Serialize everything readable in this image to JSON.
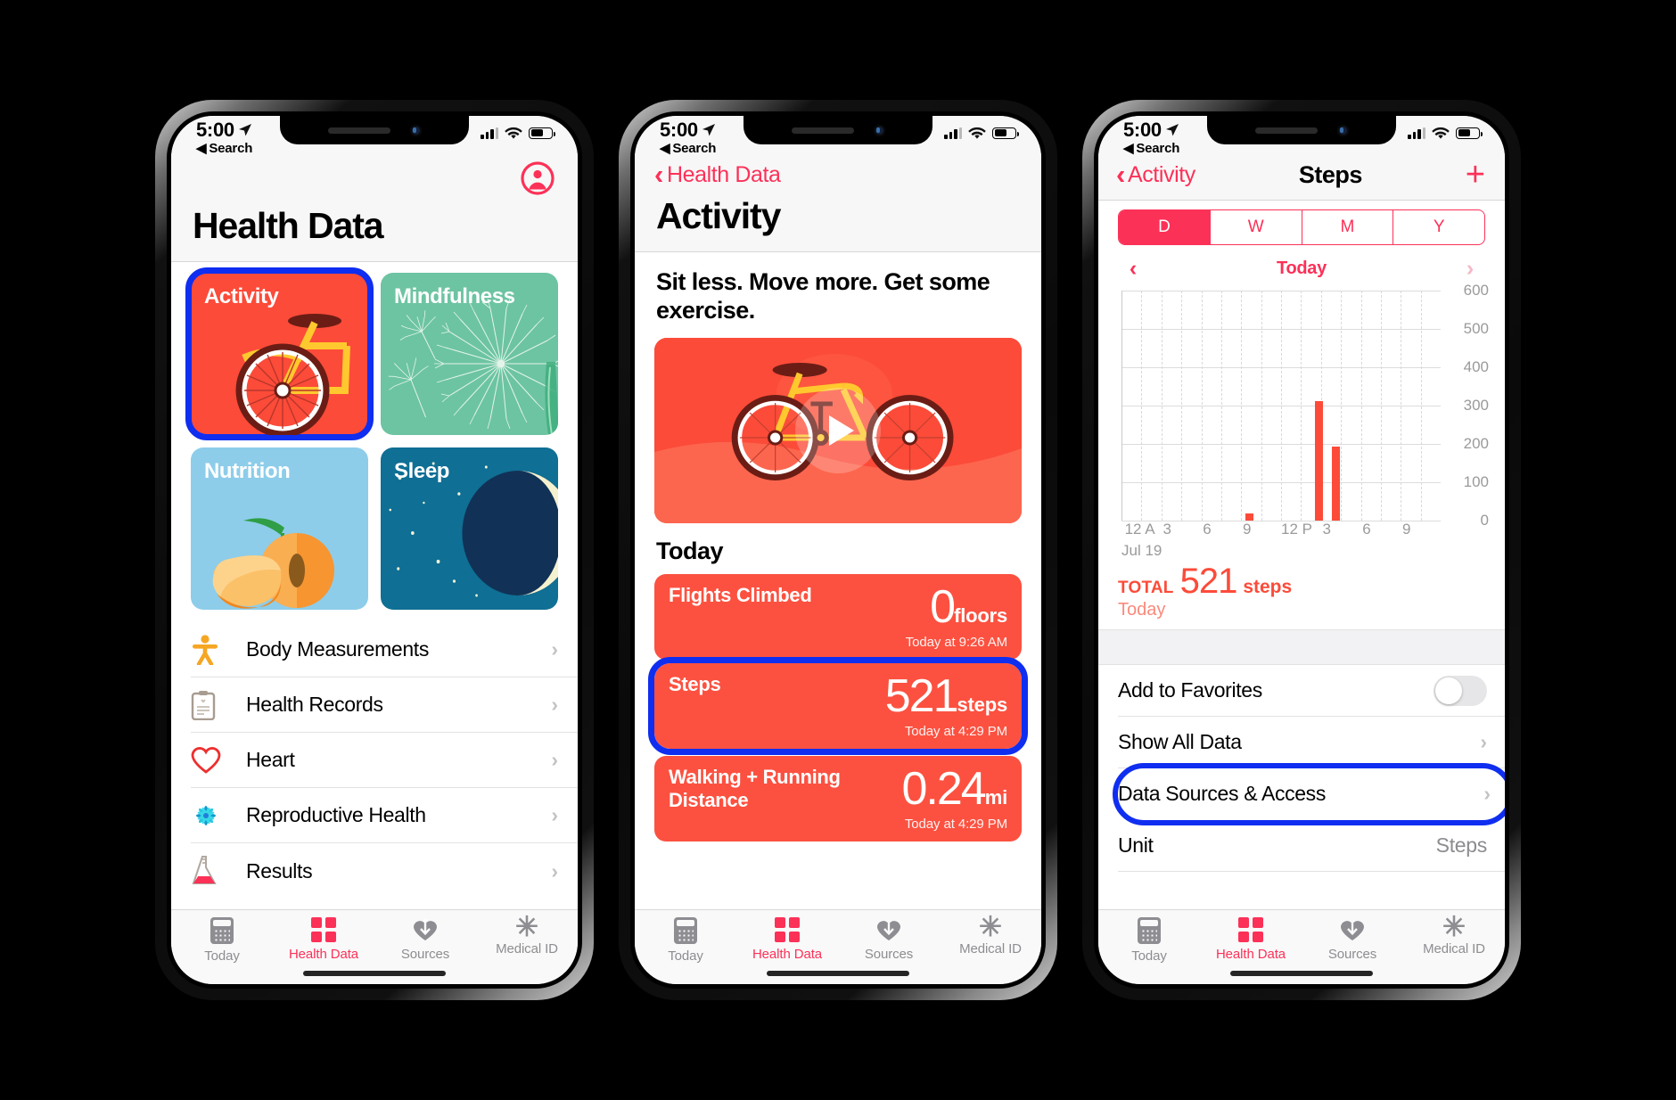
{
  "status_bar": {
    "time": "5:00",
    "back_label": "Search",
    "location_icon": "location-arrow-icon",
    "signal_icon": "cellular-bars-icon",
    "wifi_icon": "wifi-icon",
    "battery_icon": "battery-icon"
  },
  "tabbar": {
    "items": [
      {
        "label": "Today",
        "icon": "calendar-today-icon",
        "active": false
      },
      {
        "label": "Health Data",
        "icon": "four-squares-grid-icon",
        "active": true
      },
      {
        "label": "Sources",
        "icon": "heart-download-icon",
        "active": false
      },
      {
        "label": "Medical ID",
        "icon": "asterisk-medical-icon",
        "active": false
      }
    ]
  },
  "colors": {
    "accent_pink": "#fc3158",
    "activity_red": "#fc4b39",
    "card_red": "#fc5140",
    "highlight_blue": "#0f2ef0",
    "mindfulness_green": "#6dc4a2",
    "nutrition_blue": "#8dcdea",
    "sleep_navy": "#0f6f94"
  },
  "phone1": {
    "title": "Health Data",
    "profile_icon": "profile-avatar-icon",
    "tiles": [
      {
        "label": "Activity",
        "icon": "bicycle-icon",
        "highlighted": true
      },
      {
        "label": "Mindfulness",
        "icon": "dandelion-icon",
        "highlighted": false
      },
      {
        "label": "Nutrition",
        "icon": "peach-icon",
        "highlighted": false
      },
      {
        "label": "Sleep",
        "icon": "moon-stars-icon",
        "highlighted": false
      }
    ],
    "list": [
      {
        "label": "Body Measurements",
        "icon": "body-figure-icon"
      },
      {
        "label": "Health Records",
        "icon": "clipboard-records-icon"
      },
      {
        "label": "Heart",
        "icon": "heart-outline-icon"
      },
      {
        "label": "Reproductive Health",
        "icon": "flower-burst-icon"
      },
      {
        "label": "Results",
        "icon": "lab-flask-icon"
      }
    ]
  },
  "phone2": {
    "back_label": "Health Data",
    "title": "Activity",
    "promo_headline": "Sit less. Move more. Get some exercise.",
    "promo_icon": "bicycle-illustration",
    "play_icon": "play-button-icon",
    "section_header": "Today",
    "cards": [
      {
        "name": "Flights Climbed",
        "value": "0",
        "unit": "floors",
        "time": "Today at 9:26 AM",
        "highlighted": false
      },
      {
        "name": "Steps",
        "value": "521",
        "unit": "steps",
        "time": "Today at 4:29 PM",
        "highlighted": true
      },
      {
        "name": "Walking + Running Distance",
        "value": "0.24",
        "unit": "mi",
        "time": "Today at 4:29 PM",
        "highlighted": false
      }
    ]
  },
  "phone3": {
    "back_label": "Activity",
    "title": "Steps",
    "add_icon": "plus-icon",
    "segments": [
      {
        "label": "D",
        "active": true
      },
      {
        "label": "W",
        "active": false
      },
      {
        "label": "M",
        "active": false
      },
      {
        "label": "Y",
        "active": false
      }
    ],
    "date_nav": {
      "prev_icon": "chevron-left-icon",
      "label": "Today",
      "next_icon": "chevron-right-icon"
    },
    "total": {
      "prefix": "TOTAL",
      "value": "521",
      "unit": "steps",
      "sublabel": "Today"
    },
    "list": [
      {
        "label": "Add to Favorites",
        "control": "toggle",
        "value": "",
        "highlighted": false
      },
      {
        "label": "Show All Data",
        "control": "chevron",
        "value": "",
        "highlighted": false
      },
      {
        "label": "Data Sources & Access",
        "control": "chevron",
        "value": "",
        "highlighted": true
      },
      {
        "label": "Unit",
        "control": "value",
        "value": "Steps",
        "highlighted": false
      }
    ]
  },
  "chart_data": {
    "type": "bar",
    "title": "Steps",
    "xlabel": "",
    "ylabel": "",
    "date_label": "Jul 19",
    "ylim": [
      0,
      600
    ],
    "yticks": [
      0,
      100,
      200,
      300,
      400,
      500,
      600
    ],
    "ytick_labels": [
      "0",
      "100",
      "200",
      "300",
      "400",
      "500",
      "600"
    ],
    "xticks": [
      "12 A",
      "3",
      "6",
      "9",
      "12 P",
      "3",
      "6",
      "9"
    ],
    "grid": true,
    "bar_color": "#fc4b39",
    "series": [
      {
        "name": "Steps",
        "points": [
          {
            "x": "9 AM",
            "hour": 9.4,
            "value": 18
          },
          {
            "x": "2 PM",
            "hour": 14.6,
            "value": 312
          },
          {
            "x": "4 PM",
            "hour": 15.9,
            "value": 191
          }
        ]
      }
    ],
    "total": 521
  }
}
